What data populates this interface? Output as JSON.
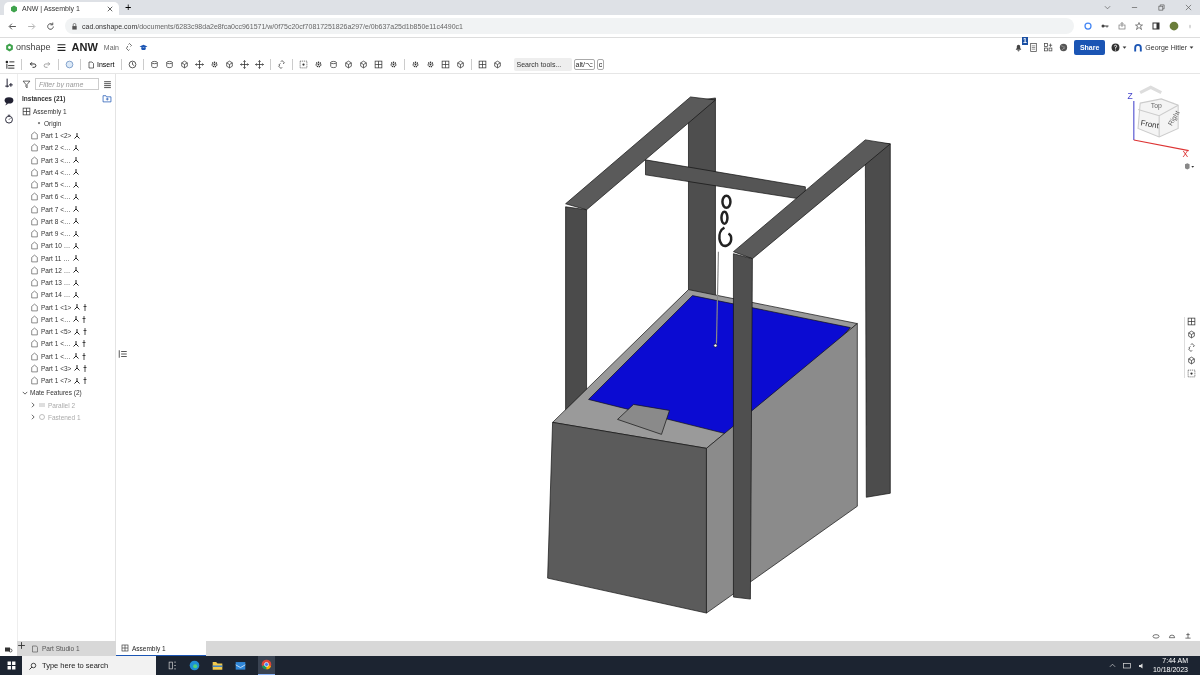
{
  "browser": {
    "tab_title": "ANW | Assembly 1",
    "new_tab": "+",
    "url_host": "cad.onshape.com",
    "url_path": "/documents/6283c98da2e8fca0cc961571/w/0f75c20cf70817251826a297/e/0b637a25d1b850e11c4490c1"
  },
  "header": {
    "logo": "onshape",
    "document": "ANW",
    "branch": "Main",
    "notifications": "1",
    "share": "Share",
    "user": "George Hitler"
  },
  "toolbar": {
    "insert": "Insert",
    "search_placeholder": "Search tools...",
    "shortcut": [
      "alt/⌥",
      "c"
    ]
  },
  "tree": {
    "filter_placeholder": "Filter by name",
    "instances_title": "Instances (21)",
    "root": {
      "label": "Assembly 1",
      "kind": "assembly",
      "children": [
        {
          "label": "Origin",
          "kind": "origin",
          "pinned": false
        },
        {
          "label": "Part 1 <2>",
          "kind": "part",
          "pinned": false
        },
        {
          "label": "Part 2 <…",
          "kind": "part",
          "pinned": false
        },
        {
          "label": "Part 3 <…",
          "kind": "part",
          "pinned": false
        },
        {
          "label": "Part 4 <…",
          "kind": "part",
          "pinned": false
        },
        {
          "label": "Part 5 <…",
          "kind": "part",
          "pinned": false
        },
        {
          "label": "Part 6 <…",
          "kind": "part",
          "pinned": false
        },
        {
          "label": "Part 7 <…",
          "kind": "part",
          "pinned": false
        },
        {
          "label": "Part 8 <…",
          "kind": "part",
          "pinned": false
        },
        {
          "label": "Part 9 <…",
          "kind": "part",
          "pinned": false
        },
        {
          "label": "Part 10 …",
          "kind": "part",
          "pinned": false
        },
        {
          "label": "Part 11 …",
          "kind": "part",
          "pinned": false
        },
        {
          "label": "Part 12 …",
          "kind": "part",
          "pinned": false
        },
        {
          "label": "Part 13 …",
          "kind": "part",
          "pinned": false
        },
        {
          "label": "Part 14 …",
          "kind": "part",
          "pinned": false
        },
        {
          "label": "Part 1 <1>",
          "kind": "part",
          "pinned": true
        },
        {
          "label": "Part 1 <…",
          "kind": "part",
          "pinned": true
        },
        {
          "label": "Part 1 <5>",
          "kind": "part",
          "pinned": true
        },
        {
          "label": "Part 1 <…",
          "kind": "part",
          "pinned": true
        },
        {
          "label": "Part 1 <…",
          "kind": "part",
          "pinned": true
        },
        {
          "label": "Part 1 <3>",
          "kind": "part",
          "pinned": true
        },
        {
          "label": "Part 1 <7>",
          "kind": "part",
          "pinned": true
        }
      ]
    },
    "mate_features": {
      "label": "Mate Features (2)",
      "expanded": true,
      "children": [
        {
          "label": "Parallel 2",
          "kind": "parallel",
          "expanded": false,
          "disabled": true
        },
        {
          "label": "Fastened 1",
          "kind": "fastened",
          "expanded": false,
          "disabled": true
        }
      ]
    }
  },
  "view_cube": {
    "faces": [
      "Top",
      "Front",
      "Right"
    ],
    "axes": [
      "Z",
      "X"
    ]
  },
  "doc_tabs": [
    {
      "label": "Part Studio 1",
      "kind": "part_studio",
      "selected": false
    },
    {
      "label": "Assembly 1",
      "kind": "assembly",
      "selected": true
    }
  ],
  "taskbar": {
    "search_placeholder": "Type here to search",
    "time": "7:44 AM",
    "date": "10/18/2023"
  }
}
